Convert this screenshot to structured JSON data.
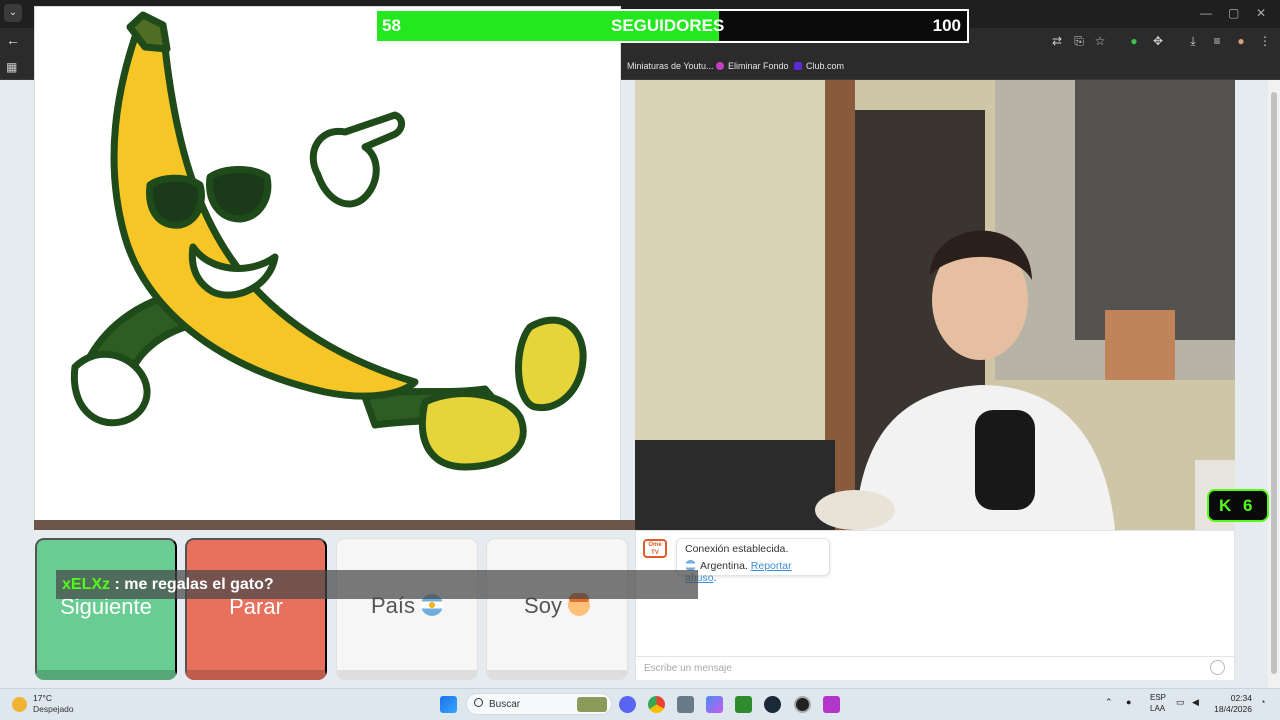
{
  "browser": {
    "bookmarks": [
      {
        "label": "Miniaturas de Youtu...",
        "color": "#444444"
      },
      {
        "label": "Eliminar Fondo",
        "color": "#c53cc7"
      },
      {
        "label": "Club.com",
        "color": "#5b2ad6"
      }
    ]
  },
  "overlay": {
    "followers": {
      "current": "58",
      "label": "SEGUIDORES",
      "goal": "100",
      "progress": 0.58,
      "color": "#22e81d"
    },
    "kick": {
      "logo": "K",
      "count": "6",
      "color": "#53fc18"
    },
    "chat": {
      "user": "xELXz",
      "message": " : me regalas el gato?"
    }
  },
  "controls": {
    "next": "Siguiente",
    "stop": "Parar",
    "country": "País",
    "me": "Soy"
  },
  "chat_panel": {
    "logo": "Ome TV",
    "connected": "Conexión establecida.",
    "country": "Argentina.",
    "report": "Reportar abuso",
    "period": ".",
    "input_placeholder": "Escribe un mensaje"
  },
  "taskbar": {
    "temperature": "17°C",
    "weather": "Despejado",
    "search": "Buscar",
    "lang1": "ESP",
    "lang2": "LAA",
    "time": "02:34",
    "date": "18/4/2026"
  }
}
